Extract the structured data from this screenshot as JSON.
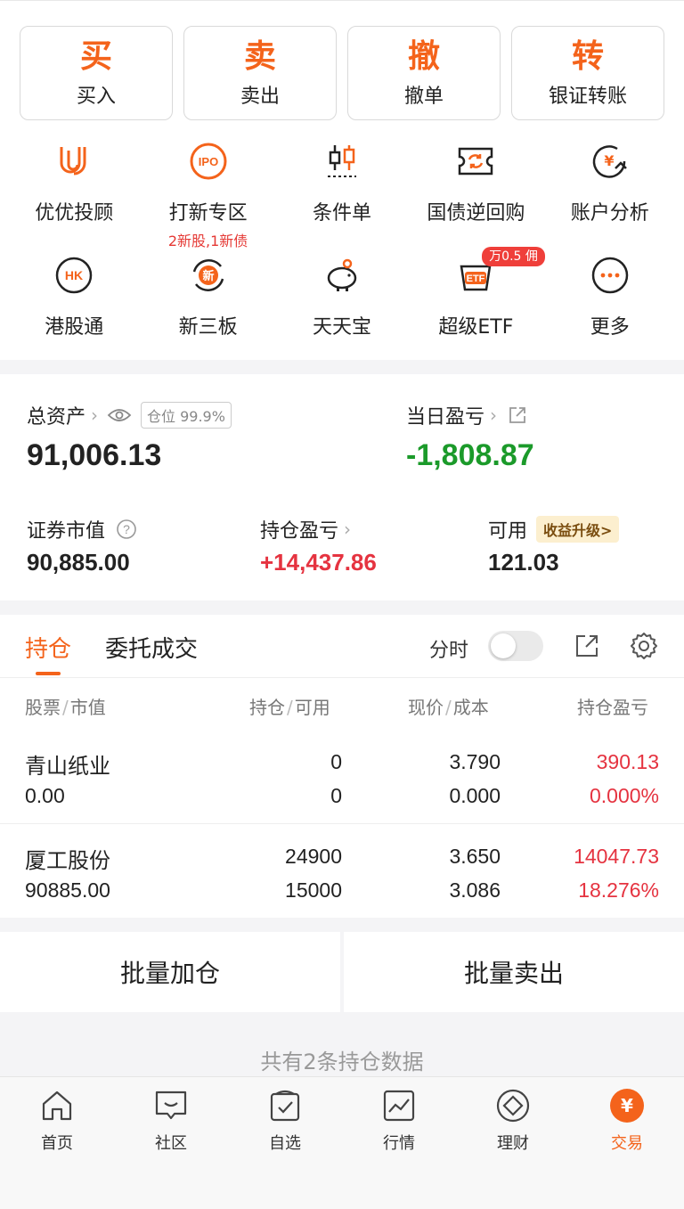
{
  "trade_buttons": [
    {
      "big": "买",
      "small": "买入"
    },
    {
      "big": "卖",
      "small": "卖出"
    },
    {
      "big": "撤",
      "small": "撤单"
    },
    {
      "big": "转",
      "small": "银证转账"
    }
  ],
  "services_row1": [
    {
      "icon": "youyou-advisor-icon",
      "label": "优优投顾"
    },
    {
      "icon": "ipo-icon",
      "icon_text": "IPO",
      "label": "打新专区",
      "sub": "2新股,1新债"
    },
    {
      "icon": "candlestick-icon",
      "label": "条件单"
    },
    {
      "icon": "repo-icon",
      "label": "国债逆回购"
    },
    {
      "icon": "account-analysis-icon",
      "label": "账户分析"
    }
  ],
  "services_row2": [
    {
      "icon": "hk-icon",
      "icon_text": "HK",
      "label": "港股通"
    },
    {
      "icon": "new-third-board-icon",
      "icon_text": "新",
      "label": "新三板"
    },
    {
      "icon": "piggy-bank-icon",
      "label": "天天宝"
    },
    {
      "icon": "etf-icon",
      "icon_text": "ETF",
      "label": "超级ETF",
      "badge": "万0.5 佣"
    },
    {
      "icon": "more-icon",
      "label": "更多"
    }
  ],
  "assets": {
    "total_label": "总资产",
    "position_tag": "仓位 99.9%",
    "total_value": "91,006.13",
    "daily_pl_label": "当日盈亏",
    "daily_pl_value": "-1,808.87",
    "market_value_label": "证券市值",
    "market_value": "90,885.00",
    "holding_pl_label": "持仓盈亏",
    "holding_pl_value": "+14,437.86",
    "available_label": "可用",
    "upgrade_label": "收益升级>",
    "available_value": "121.03"
  },
  "holdings": {
    "tab_holdings": "持仓",
    "tab_orders": "委托成交",
    "fenshi_label": "分时",
    "col_stock": "股票",
    "col_mv": "市值",
    "col_pos": "持仓",
    "col_avail": "可用",
    "col_price": "现价",
    "col_cost": "成本",
    "col_pl": "持仓盈亏",
    "rows": [
      {
        "name": "青山纸业",
        "market_value": "0.00",
        "position": "0",
        "available": "0",
        "price": "3.790",
        "cost": "0.000",
        "pl": "390.13",
        "pl_pct": "0.000%"
      },
      {
        "name": "厦工股份",
        "market_value": "90885.00",
        "position": "24900",
        "available": "15000",
        "price": "3.650",
        "cost": "3.086",
        "pl": "14047.73",
        "pl_pct": "18.276%"
      }
    ]
  },
  "batch": {
    "add": "批量加仓",
    "sell": "批量卖出"
  },
  "footer_note": "共有2条持仓数据",
  "tabbar": [
    {
      "icon": "home-icon",
      "label": "首页"
    },
    {
      "icon": "community-icon",
      "label": "社区"
    },
    {
      "icon": "watchlist-icon",
      "label": "自选"
    },
    {
      "icon": "market-icon",
      "label": "行情"
    },
    {
      "icon": "wealth-icon",
      "label": "理财"
    },
    {
      "icon": "trade-icon",
      "label": "交易",
      "active": true
    }
  ],
  "colors": {
    "accent": "#f4631b",
    "up": "#e53340",
    "down": "#1b9a2a"
  }
}
